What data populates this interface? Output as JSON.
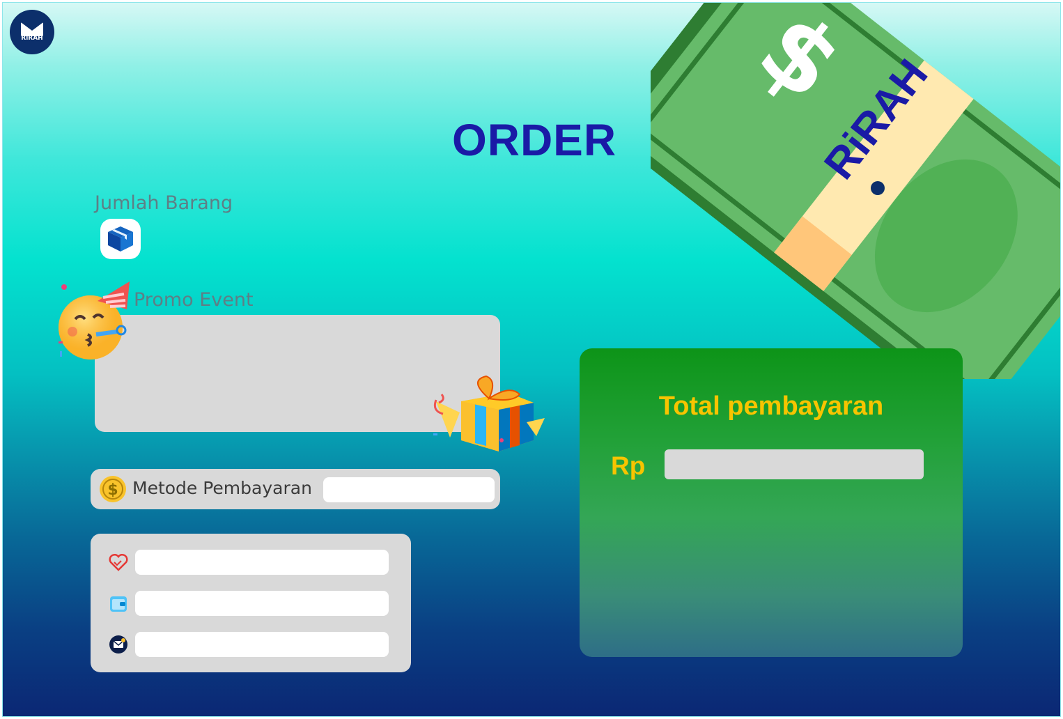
{
  "logo": {
    "text": "RiRAH"
  },
  "page": {
    "title": "ORDER"
  },
  "jumlah": {
    "label": "Jumlah Barang"
  },
  "promo": {
    "label": "Promo Event"
  },
  "payment": {
    "label": "Metode Pembayaran",
    "value": ""
  },
  "contact": {
    "field_1": "",
    "field_2": "",
    "field_3": ""
  },
  "total": {
    "title": "Total pembayaran",
    "currency": "Rp",
    "value": ""
  },
  "banknote": {
    "symbol": "$",
    "brand": "RiRAH"
  },
  "colors": {
    "title": "#1a1aa6",
    "accent": "#f7c400",
    "card_green": "#0d9418",
    "field": "#d9d9d9"
  }
}
